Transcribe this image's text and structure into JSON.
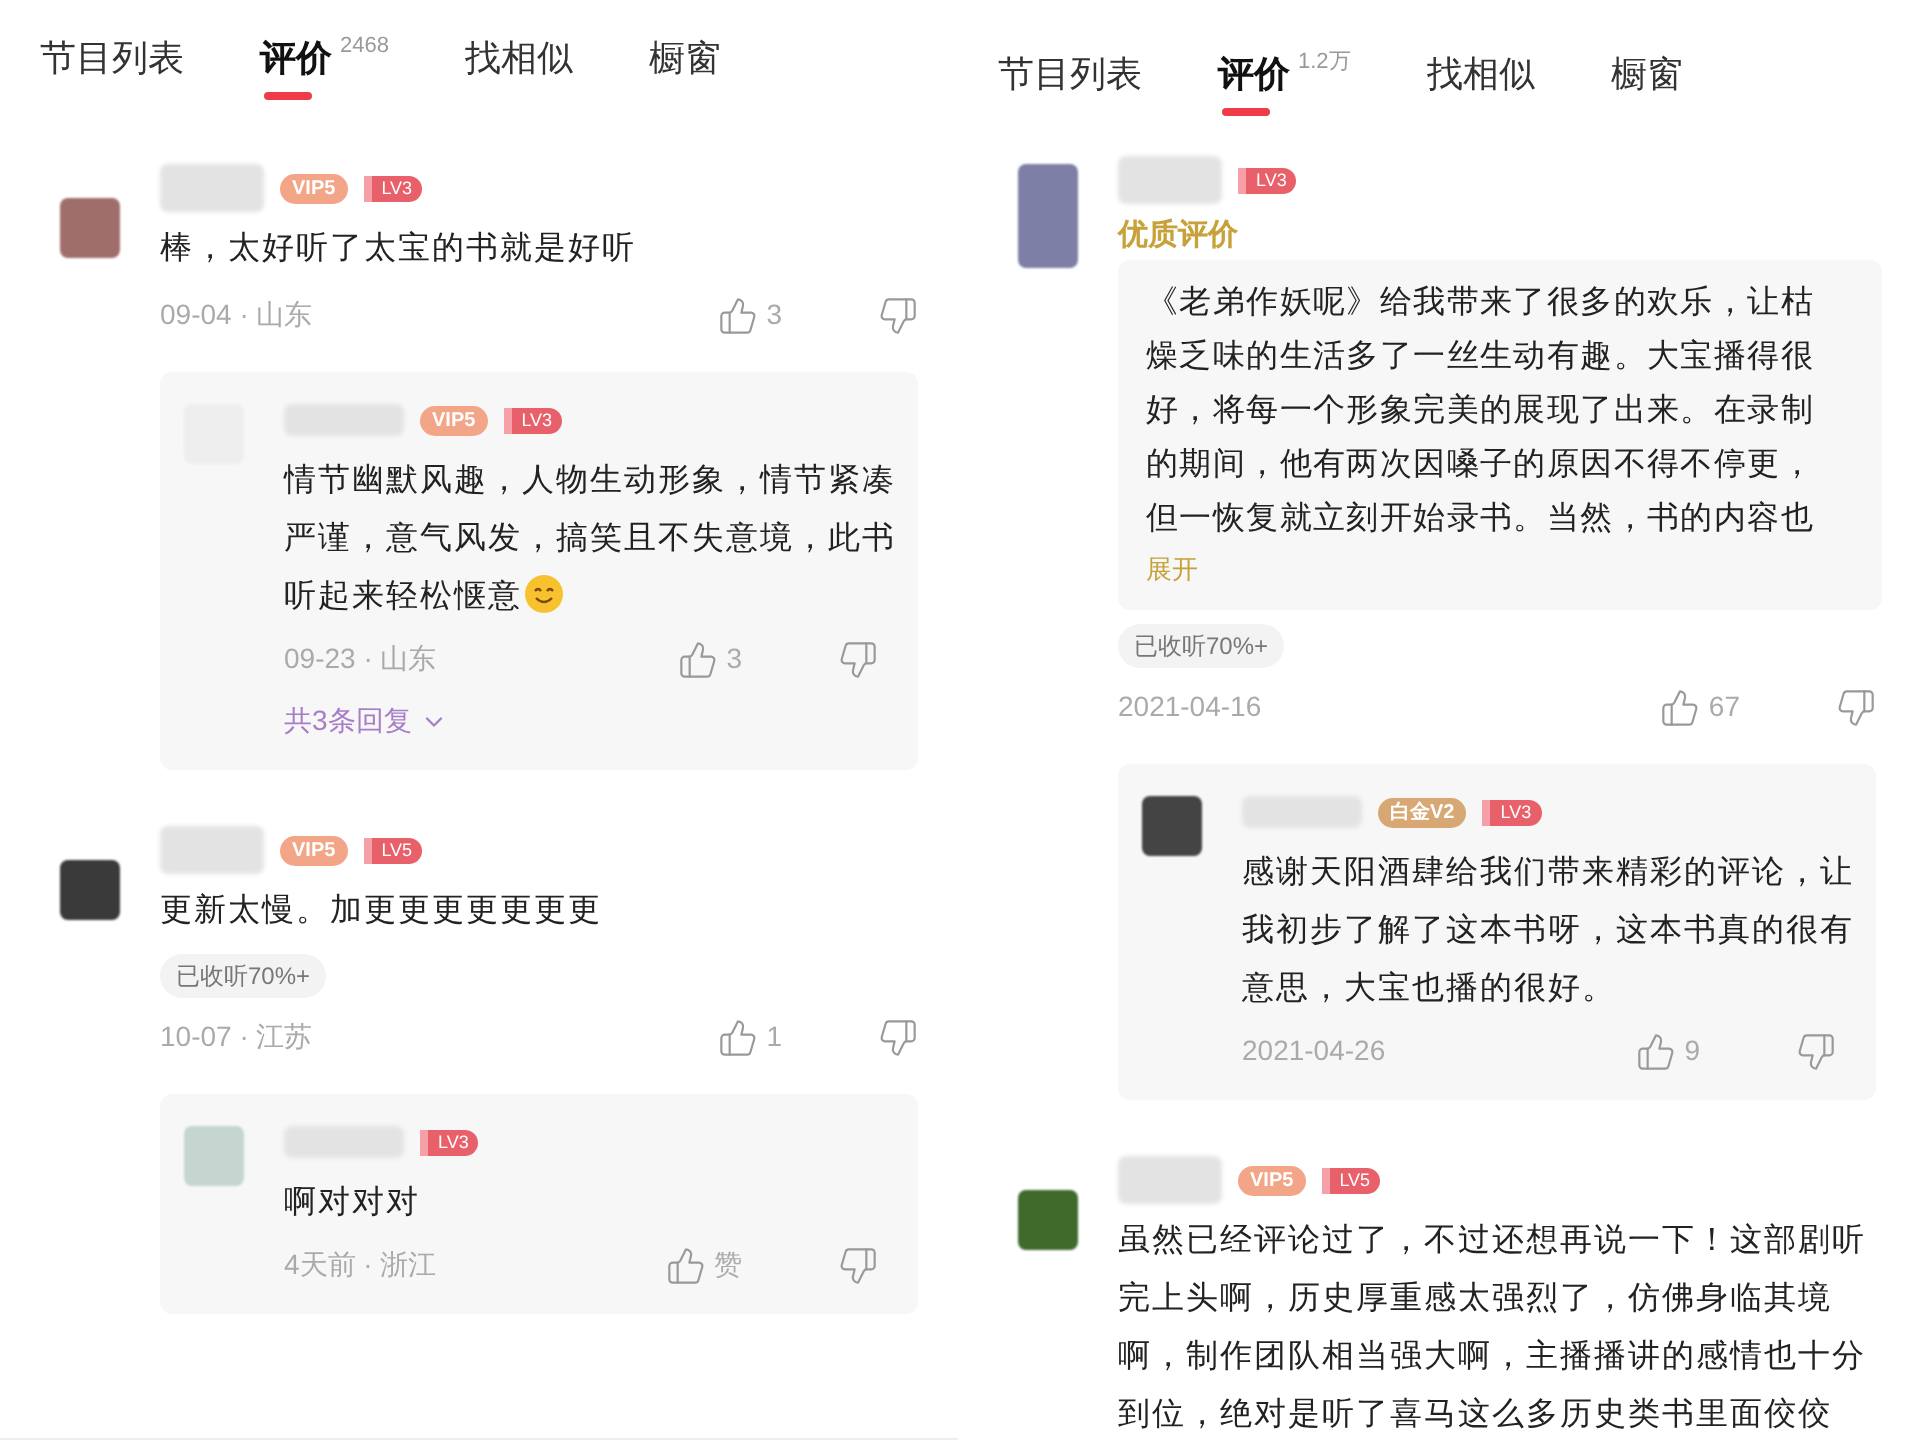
{
  "panels": [
    {
      "tabs": [
        {
          "label": "节目列表",
          "selected": false
        },
        {
          "label": "评价",
          "count": "2468",
          "selected": true
        },
        {
          "label": "找相似",
          "selected": false
        },
        {
          "label": "橱窗",
          "selected": false
        }
      ],
      "comments": [
        {
          "kind": "plain",
          "avatar": {
            "color": "#a06e6a"
          },
          "badges": [
            {
              "kind": "vip",
              "text": "VIP5"
            },
            {
              "kind": "lv",
              "text": "LV3"
            }
          ],
          "text": "棒，太好听了太宝的书就是好听",
          "meta": "09-04 · 山东",
          "likes": "3",
          "replies": [
            {
              "avatar": {
                "color": "#eeeeee"
              },
              "badges": [
                {
                  "kind": "vip",
                  "text": "VIP5"
                },
                {
                  "kind": "lv",
                  "text": "LV3"
                }
              ],
              "text": "情节幽默风趣，人物生动形象，情节紧凑严谨，意气风发，搞笑且不失意境，此书听起来轻松惬意",
              "emoji": true,
              "meta": "09-23 · 山东",
              "likes": "3"
            }
          ],
          "more_replies": "共3条回复"
        },
        {
          "kind": "plain",
          "avatar": {
            "color": "#3a3a3a"
          },
          "badges": [
            {
              "kind": "vip",
              "text": "VIP5"
            },
            {
              "kind": "lv",
              "text": "LV5"
            }
          ],
          "text": "更新太慢。加更更更更更更更",
          "tag": "已收听70%+",
          "meta": "10-07 · 江苏",
          "likes": "1",
          "replies": [
            {
              "avatar": {
                "color": "#c4d6cf"
              },
              "badges": [
                {
                  "kind": "lv",
                  "text": "LV3"
                }
              ],
              "text": "啊对对对",
              "emoji": false,
              "meta": "4天前 · 浙江",
              "likes": "赞"
            }
          ]
        }
      ]
    },
    {
      "tabs": [
        {
          "label": "节目列表",
          "selected": false
        },
        {
          "label": "评价",
          "count": "1.2万",
          "selected": true
        },
        {
          "label": "找相似",
          "selected": false
        },
        {
          "label": "橱窗",
          "selected": false
        }
      ],
      "comments": [
        {
          "kind": "featured",
          "avatar": {
            "color": "#7d7fa6"
          },
          "badges": [
            {
              "kind": "lv",
              "text": "LV3"
            }
          ],
          "quality_label": "优质评价",
          "text": "《老弟作妖呢》给我带来了很多的欢乐，让枯燥乏味的生活多了一丝生动有趣。大宝播得很好，将每一个形象完美的展现了出来。在录制的期间，他有两次因嗓子的原因不得不停更，但一恢复就立刻开始录书。当然，书的内容也",
          "expand": "展开",
          "tag": "已收听70%+",
          "meta": "2021-04-16",
          "likes": "67",
          "replies": [
            {
              "avatar": {
                "color": "#444444"
              },
              "badges": [
                {
                  "kind": "platinum",
                  "text": "白金V2"
                },
                {
                  "kind": "lv",
                  "text": "LV3"
                }
              ],
              "text": "感谢天阳酒肆给我们带来精彩的评论，让我初步了解了这本书呀，这本书真的很有意思，大宝也播的很好。",
              "emoji": false,
              "meta": "2021-04-26",
              "likes": "9"
            }
          ]
        },
        {
          "kind": "plain",
          "avatar": {
            "color": "#3f6a2c"
          },
          "badges": [
            {
              "kind": "vip",
              "text": "VIP5"
            },
            {
              "kind": "lv",
              "text": "LV5"
            }
          ],
          "text": "虽然已经评论过了，不过还想再说一下！这部剧听完上头啊，历史厚重感太强烈了，仿佛身临其境啊，制作团队相当强大啊，主播播讲的感情也十分到位，绝对是听了喜马这么多历史类书里面佼佼"
        }
      ]
    }
  ]
}
